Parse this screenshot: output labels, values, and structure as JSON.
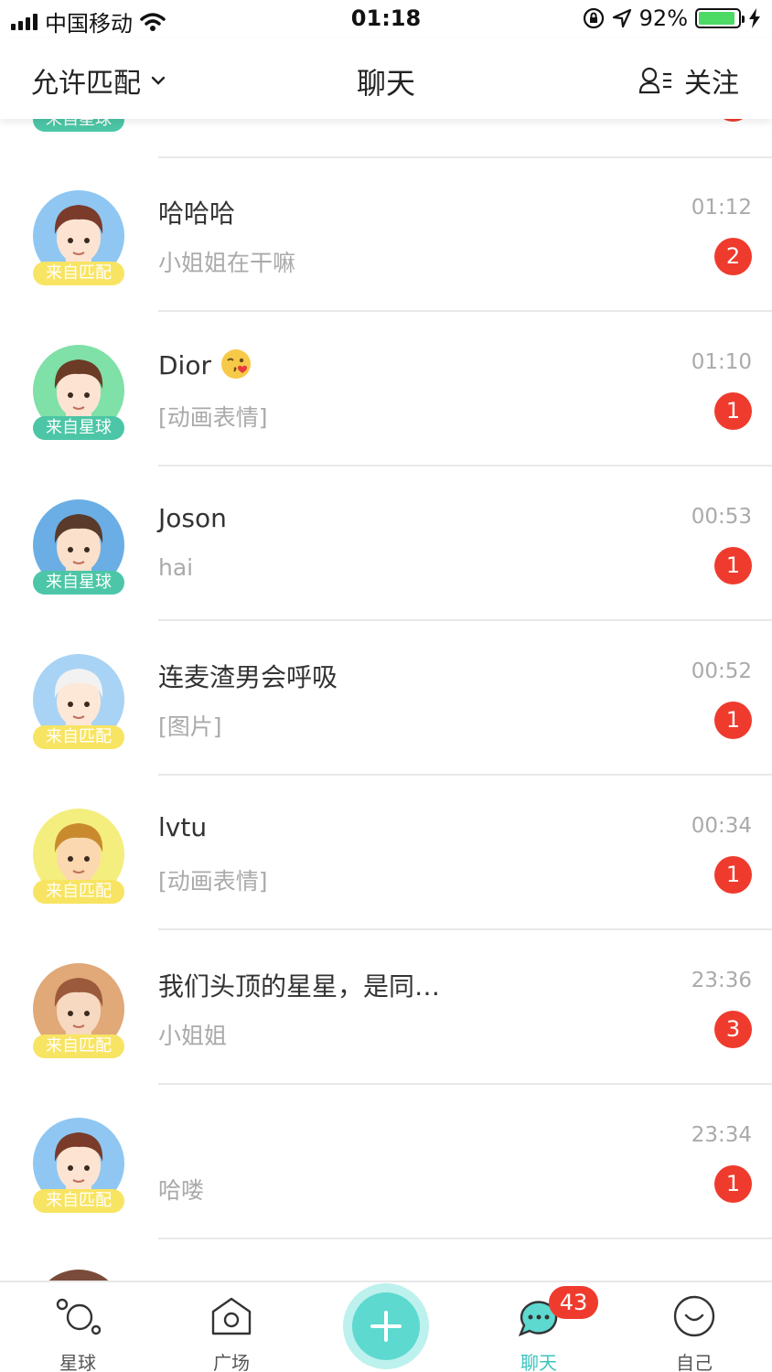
{
  "status_bar": {
    "carrier": "中国移动",
    "time": "01:18",
    "battery": "92%",
    "battery_level": 0.92
  },
  "nav": {
    "left_label": "允许匹配",
    "title": "聊天",
    "right_label": "关注"
  },
  "colors": {
    "match_badge": "#f8e463",
    "planet_badge": "#4cc6a6",
    "accent": "#3bc4be",
    "unread": "#ef3b2d"
  },
  "chats": [
    {
      "name": "哈哈哈",
      "message": "小姐姐在干嘛",
      "time": "01:12",
      "unread": "2",
      "source": "来自匹配",
      "source_type": "match",
      "avatar": "boy-brown-hair-icon"
    },
    {
      "name": "Dior",
      "message": "[动画表情]",
      "time": "01:10",
      "unread": "1",
      "source": "来自星球",
      "source_type": "planet",
      "avatar": "boy-wink-icon",
      "emoji": "kiss-emoji-icon"
    },
    {
      "name": "Joson",
      "message": "hai",
      "time": "00:53",
      "unread": "1",
      "source": "来自星球",
      "source_type": "planet",
      "avatar": "boy-undercut-icon"
    },
    {
      "name": "连麦渣男会呼吸",
      "message": "[图片]",
      "time": "00:52",
      "unread": "1",
      "source": "来自匹配",
      "source_type": "match",
      "avatar": "boy-white-hair-icon"
    },
    {
      "name": "lvtu",
      "message": "[动画表情]",
      "time": "00:34",
      "unread": "1",
      "source": "来自匹配",
      "source_type": "match",
      "avatar": "cartoon-boy-icon"
    },
    {
      "name": "我们头顶的星星，是同…",
      "message": "小姐姐",
      "time": "23:36",
      "unread": "3",
      "source": "来自匹配",
      "source_type": "match",
      "avatar": "anime-boy-icon"
    },
    {
      "name": "",
      "message": "哈喽",
      "time": "23:34",
      "unread": "1",
      "source": "来自匹配",
      "source_type": "match",
      "avatar": "boy-brown-hair-icon"
    }
  ],
  "partial_top_item": {
    "source": "来自星球"
  },
  "tab_bar": {
    "tabs": [
      {
        "label": "星球",
        "icon": "planet-icon"
      },
      {
        "label": "广场",
        "icon": "home-icon"
      },
      {
        "label": "聊天",
        "icon": "chat-icon"
      },
      {
        "label": "自己",
        "icon": "smile-icon"
      }
    ],
    "chat_badge": "43",
    "active_tab": "聊天"
  }
}
